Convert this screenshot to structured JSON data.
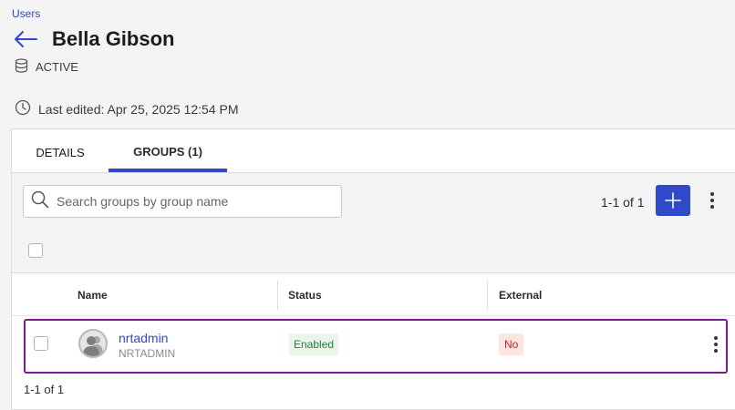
{
  "breadcrumb": {
    "label": "Users"
  },
  "header": {
    "title": "Bella Gibson",
    "status": "ACTIVE"
  },
  "meta": {
    "last_edited": "Last edited: Apr 25, 2025 12:54 PM"
  },
  "tabs": [
    {
      "label": "DETAILS",
      "active": false
    },
    {
      "label": "GROUPS (1)",
      "active": true
    }
  ],
  "toolbar": {
    "search_placeholder": "Search groups by group name",
    "pagination": "1-1 of 1",
    "add_icon": "plus-icon",
    "more_icon": "kebab-icon"
  },
  "table": {
    "columns": [
      "Name",
      "Status",
      "External"
    ],
    "rows": [
      {
        "name": "nrtadmin",
        "subname": "NRTADMIN",
        "status": "Enabled",
        "external": "No"
      }
    ]
  },
  "footer": {
    "pagination": "1-1 of 1"
  },
  "colors": {
    "accent": "#2f49c8",
    "highlight_border": "#7b1b8c",
    "enabled_bg": "#e9f6ec",
    "enabled_text": "#2d7a3c",
    "no_bg": "#fde6e2",
    "no_text": "#b3261e"
  }
}
